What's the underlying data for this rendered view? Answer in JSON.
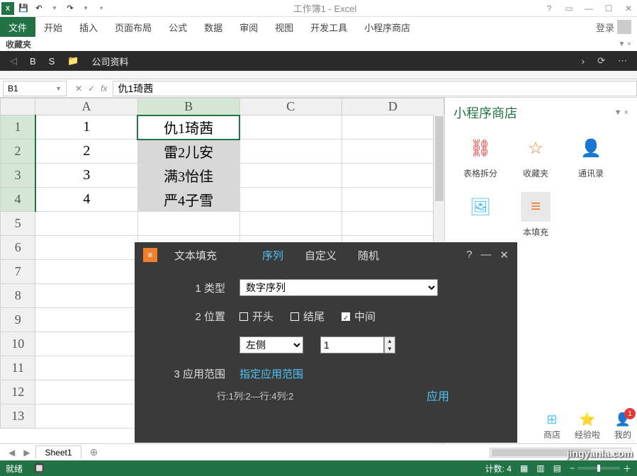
{
  "window": {
    "title": "工作簿1 - Excel"
  },
  "qat": {
    "save": "💾",
    "undo": "↶",
    "redo": "↷"
  },
  "winbtns": {
    "help": "?",
    "opts": "▭",
    "min": "—",
    "max": "☐",
    "close": "✕"
  },
  "ribbon": {
    "file": "文件",
    "tabs": [
      "开始",
      "插入",
      "页面布局",
      "公式",
      "数据",
      "审阅",
      "视图",
      "开发工具",
      "小程序商店"
    ],
    "login": "登录"
  },
  "favbar": {
    "label": "收藏夹"
  },
  "darkbar": {
    "b": "B",
    "s": "S",
    "folder": "公司资料"
  },
  "formula": {
    "namebox": "B1",
    "value": "仇1琦茜"
  },
  "columns": [
    "A",
    "B",
    "C",
    "D"
  ],
  "rows": [
    "1",
    "2",
    "3",
    "4",
    "5",
    "6",
    "7",
    "8",
    "9",
    "10",
    "11",
    "12",
    "13"
  ],
  "cells": {
    "A": [
      "1",
      "2",
      "3",
      "4",
      "",
      "",
      "",
      "",
      "",
      "",
      "",
      "",
      ""
    ],
    "B": [
      "仇1琦茜",
      "雷2儿安",
      "满3怡佳",
      "严4子雪",
      "",
      "",
      "",
      "",
      "",
      "",
      "",
      "",
      ""
    ],
    "C": [
      "",
      "",
      "",
      "",
      "",
      "",
      "",
      "",
      "",
      "",
      "",
      "",
      ""
    ],
    "D": [
      "",
      "",
      "",
      "",
      "",
      "",
      "",
      "",
      "",
      "",
      "",
      "",
      ""
    ]
  },
  "panel": {
    "title": "小程序商店",
    "apps": [
      {
        "name": "表格拆分",
        "icon": "⛓"
      },
      {
        "name": "收藏夹",
        "icon": "☆"
      },
      {
        "name": "通讯录",
        "icon": "👤"
      },
      {
        "name": "",
        "icon": "🖼"
      },
      {
        "name": "本填充",
        "icon": "≡"
      }
    ],
    "footer": {
      "store": "商店",
      "exp": "经验啦",
      "mine": "我的",
      "badge": "1"
    }
  },
  "dialog": {
    "title": "文本填充",
    "tabs": {
      "seq": "序列",
      "custom": "自定义",
      "random": "随机"
    },
    "row1": {
      "num": "1",
      "label": "类型",
      "value": "数字序列"
    },
    "row2": {
      "num": "2",
      "label": "位置",
      "opt1": "开头",
      "opt2": "结尾",
      "opt3": "中间",
      "sel": "左侧",
      "numval": "1"
    },
    "row3": {
      "num": "3",
      "label": "应用范围",
      "link": "指定应用范围",
      "info": "行:1列:2—行:4列:2"
    },
    "apply": "应用",
    "help": "?",
    "min": "—",
    "close": "✕"
  },
  "sheettabs": {
    "tab1": "Sheet1",
    "add": "⊕"
  },
  "status": {
    "ready": "就绪",
    "macro": "🔲",
    "count_lbl": "计数:",
    "count": "4",
    "views": [
      "▦",
      "▥",
      "▤"
    ],
    "zoom_minus": "−",
    "zoom_plus": "＋"
  },
  "watermark": "jingyanla.com",
  "chart_data": null
}
